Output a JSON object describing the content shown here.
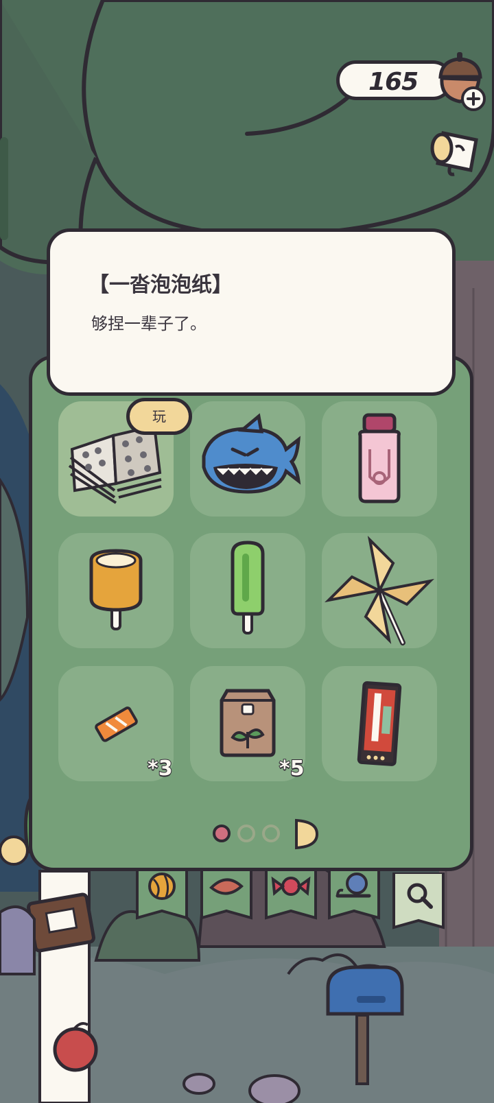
{
  "currency": {
    "amount": "165"
  },
  "item_detail": {
    "title": "【一沓泡泡纸】",
    "description": "够捏一辈子了。",
    "action_label": "玩"
  },
  "inventory": {
    "items": [
      {
        "name": "bubble-wrap-stack",
        "count": ""
      },
      {
        "name": "shark-toy",
        "count": ""
      },
      {
        "name": "pink-bottle",
        "count": ""
      },
      {
        "name": "orange-popsicle",
        "count": ""
      },
      {
        "name": "green-popsicle",
        "count": ""
      },
      {
        "name": "pinwheel",
        "count": ""
      },
      {
        "name": "ticket",
        "count": "*3"
      },
      {
        "name": "seed-bag",
        "count": "*5"
      },
      {
        "name": "snack-bar",
        "count": ""
      }
    ],
    "page_count": 3,
    "current_page": 1
  },
  "tabs": [
    {
      "icon": "yarn-ball-icon"
    },
    {
      "icon": "leaf-icon"
    },
    {
      "icon": "candy-icon"
    },
    {
      "icon": "snail-icon"
    },
    {
      "icon": "magnifier-icon"
    }
  ],
  "colors": {
    "panel": "#76a079",
    "slot": "#89ae89",
    "bubble": "#fbf8f1",
    "outline": "#2f2a33",
    "tag": "#f2d79a",
    "active_dot": "#cf6f7f"
  }
}
